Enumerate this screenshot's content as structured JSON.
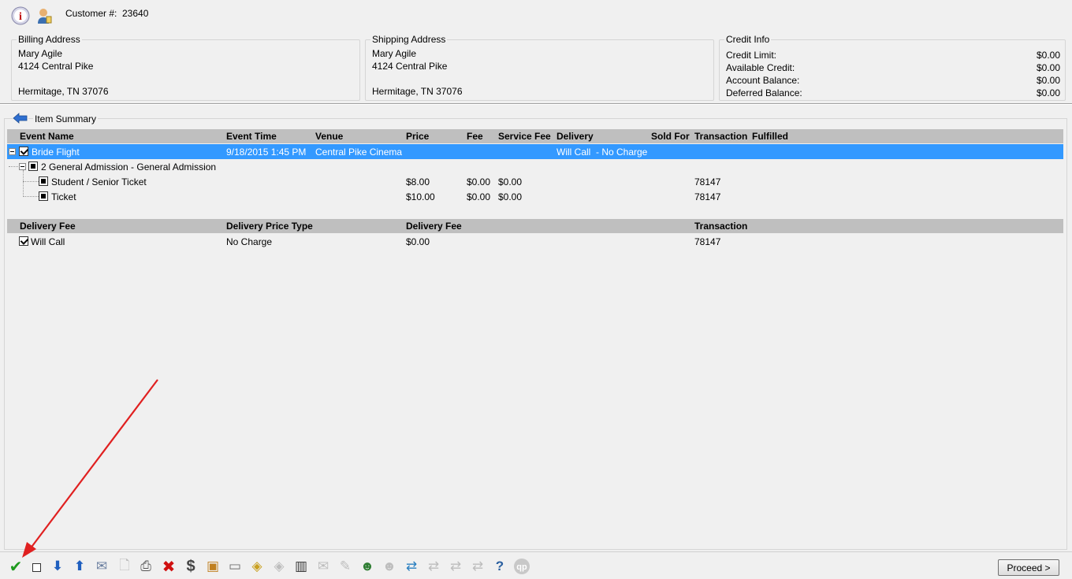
{
  "header": {
    "customer_label": "Customer #:",
    "customer_number": "23640",
    "info_icon": "info-icon",
    "user_icon": "user-icon"
  },
  "billing": {
    "legend": "Billing Address",
    "name": "Mary Agile",
    "street": "4124 Central Pike",
    "city": "Hermitage, TN 37076"
  },
  "shipping": {
    "legend": "Shipping Address",
    "name": "Mary Agile",
    "street": "4124 Central Pike",
    "city": "Hermitage, TN 37076"
  },
  "credit": {
    "legend": "Credit Info",
    "rows": [
      {
        "label": "Credit Limit:",
        "value": "$0.00"
      },
      {
        "label": "Available Credit:",
        "value": "$0.00"
      },
      {
        "label": "Account Balance:",
        "value": "$0.00"
      },
      {
        "label": "Deferred Balance:",
        "value": "$0.00"
      }
    ]
  },
  "summary": {
    "legend": "Item Summary",
    "columns": [
      "Event Name",
      "Event Time",
      "Venue",
      "Price",
      "Fee",
      "Service Fee",
      "Delivery",
      "Sold For",
      "Transaction",
      "Fulfilled"
    ],
    "event": {
      "name": "Bride Flight",
      "time": "9/18/2015 1:45 PM",
      "venue": "Central Pike Cinema",
      "delivery": "Will Call  - No Charge"
    },
    "group": {
      "label": "2 General Admission - General Admission"
    },
    "tickets": [
      {
        "name": "Student / Senior Ticket",
        "price": "$8.00",
        "fee": "$0.00",
        "service_fee": "$0.00",
        "transaction": "78147"
      },
      {
        "name": "Ticket",
        "price": "$10.00",
        "fee": "$0.00",
        "service_fee": "$0.00",
        "transaction": "78147"
      }
    ]
  },
  "delivery": {
    "columns": [
      "Delivery Fee",
      "Delivery Price Type",
      "Delivery Fee",
      "Transaction"
    ],
    "rows": [
      {
        "name": "Will Call",
        "price_type": "No Charge",
        "fee": "$0.00",
        "transaction": "78147"
      }
    ]
  },
  "toolbar": {
    "proceed_label": "Proceed >"
  },
  "colors": {
    "selection": "#3399ff",
    "header_bg": "#bfbfbf",
    "annotation_arrow": "#e02020"
  }
}
